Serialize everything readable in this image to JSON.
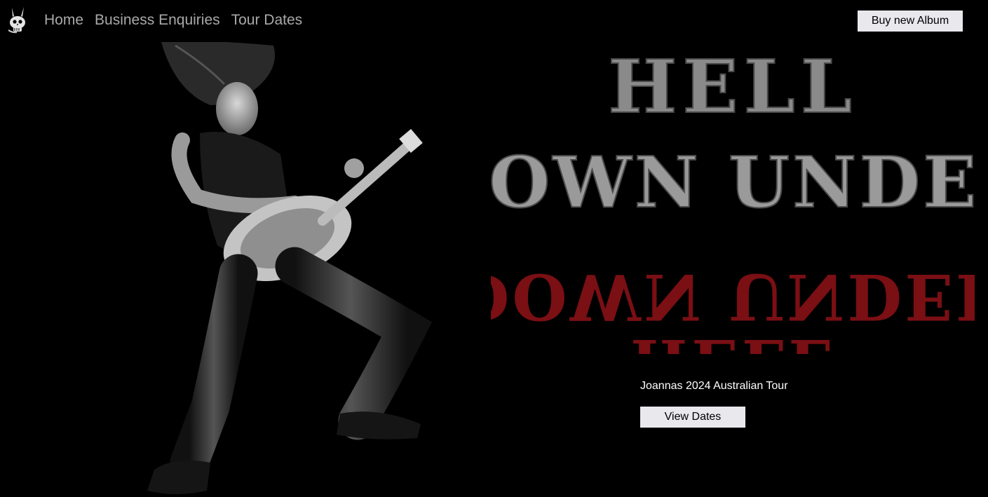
{
  "nav": {
    "logo": "skull-horns-logo",
    "links": [
      "Home",
      "Business Enquiries",
      "Tour Dates"
    ]
  },
  "header": {
    "buy_button": "Buy new Album"
  },
  "hero": {
    "image": "guitarist-photo",
    "title_line1": "HELL",
    "title_line2": "DOWN UNDER",
    "title_line3": "DOWN UNDER",
    "title_line4": "HELL",
    "title_color_main": "#8a8a8a",
    "title_color_mirror": "#7a0f14",
    "tour_text": "Joannas 2024 Australian Tour",
    "view_dates_button": "View Dates"
  }
}
